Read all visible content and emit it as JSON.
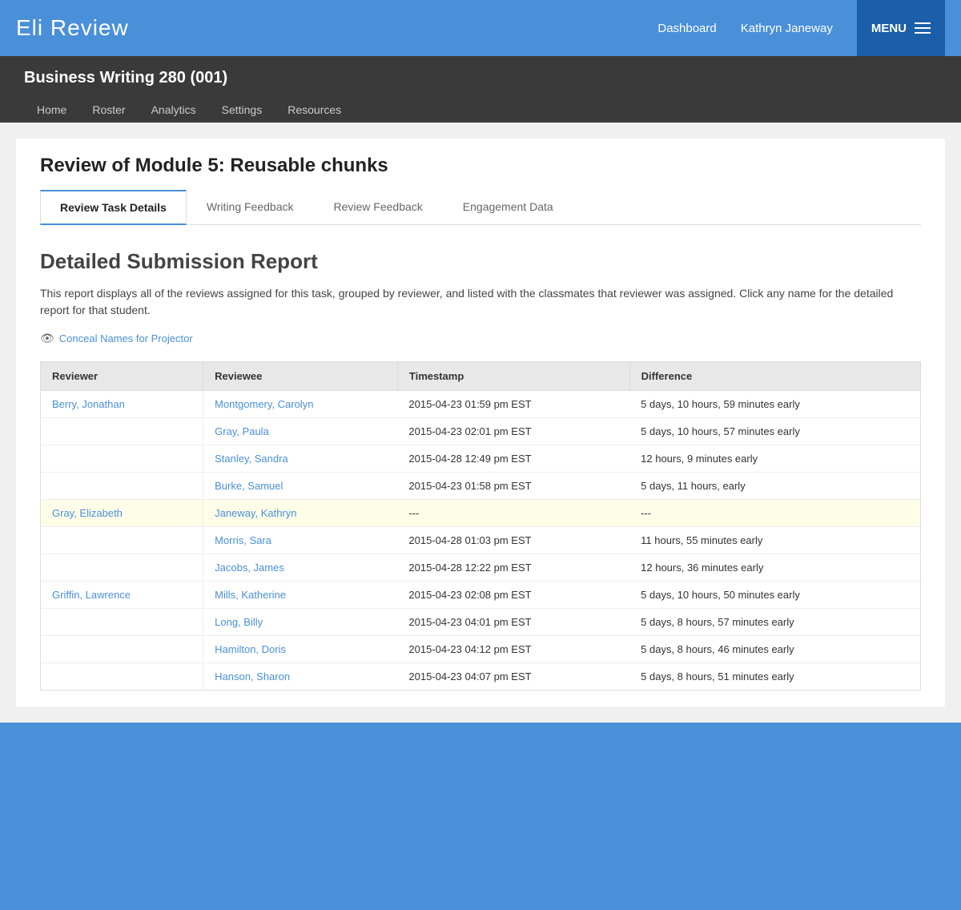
{
  "app": {
    "logo": "Eli Review",
    "nav": {
      "dashboard": "Dashboard",
      "user": "Kathryn Janeway",
      "menu": "MENU"
    }
  },
  "course": {
    "title": "Business Writing 280 (001)",
    "nav_items": [
      "Home",
      "Roster",
      "Analytics",
      "Settings",
      "Resources"
    ]
  },
  "page": {
    "title": "Review of Module 5: Reusable chunks",
    "tabs": [
      {
        "label": "Review Task Details",
        "active": true
      },
      {
        "label": "Writing Feedback",
        "active": false
      },
      {
        "label": "Review Feedback",
        "active": false
      },
      {
        "label": "Engagement Data",
        "active": false
      }
    ],
    "report": {
      "title": "Detailed Submission Report",
      "description": "This report displays all of the reviews assigned for this task, grouped by reviewer, and listed with the classmates that reviewer was assigned. Click any name for the detailed report for that student.",
      "conceal_link": "Conceal Names for Projector"
    },
    "table": {
      "headers": [
        "Reviewer",
        "Reviewee",
        "Timestamp",
        "Difference"
      ],
      "rows": [
        {
          "reviewer": "Berry, Jonathan",
          "reviewee": "Montgomery, Carolyn",
          "timestamp": "2015-04-23 01:59 pm EST",
          "difference": "5 days, 10 hours, 59 minutes early",
          "highlight": false
        },
        {
          "reviewer": "",
          "reviewee": "Gray, Paula",
          "timestamp": "2015-04-23 02:01 pm EST",
          "difference": "5 days, 10 hours, 57 minutes early",
          "highlight": false
        },
        {
          "reviewer": "",
          "reviewee": "Stanley, Sandra",
          "timestamp": "2015-04-28 12:49 pm EST",
          "difference": "12 hours, 9 minutes early",
          "highlight": false
        },
        {
          "reviewer": "",
          "reviewee": "Burke, Samuel",
          "timestamp": "2015-04-23 01:58 pm EST",
          "difference": "5 days, 11 hours, early",
          "highlight": false
        },
        {
          "reviewer": "Gray, Elizabeth",
          "reviewee": "Janeway, Kathryn",
          "timestamp": "---",
          "difference": "---",
          "highlight": true
        },
        {
          "reviewer": "",
          "reviewee": "Morris, Sara",
          "timestamp": "2015-04-28 01:03 pm EST",
          "difference": "11 hours, 55 minutes early",
          "highlight": false
        },
        {
          "reviewer": "",
          "reviewee": "Jacobs, James",
          "timestamp": "2015-04-28 12:22 pm EST",
          "difference": "12 hours, 36 minutes early",
          "highlight": false
        },
        {
          "reviewer": "Griffin, Lawrence",
          "reviewee": "Mills, Katherine",
          "timestamp": "2015-04-23 02:08 pm EST",
          "difference": "5 days, 10 hours, 50 minutes early",
          "highlight": false
        },
        {
          "reviewer": "",
          "reviewee": "Long, Billy",
          "timestamp": "2015-04-23 04:01 pm EST",
          "difference": "5 days, 8 hours, 57 minutes early",
          "highlight": false
        },
        {
          "reviewer": "",
          "reviewee": "Hamilton, Doris",
          "timestamp": "2015-04-23 04:12 pm EST",
          "difference": "5 days, 8 hours, 46 minutes early",
          "highlight": false
        },
        {
          "reviewer": "",
          "reviewee": "Hanson, Sharon",
          "timestamp": "2015-04-23 04:07 pm EST",
          "difference": "5 days, 8 hours, 51 minutes early",
          "highlight": false
        }
      ]
    }
  }
}
